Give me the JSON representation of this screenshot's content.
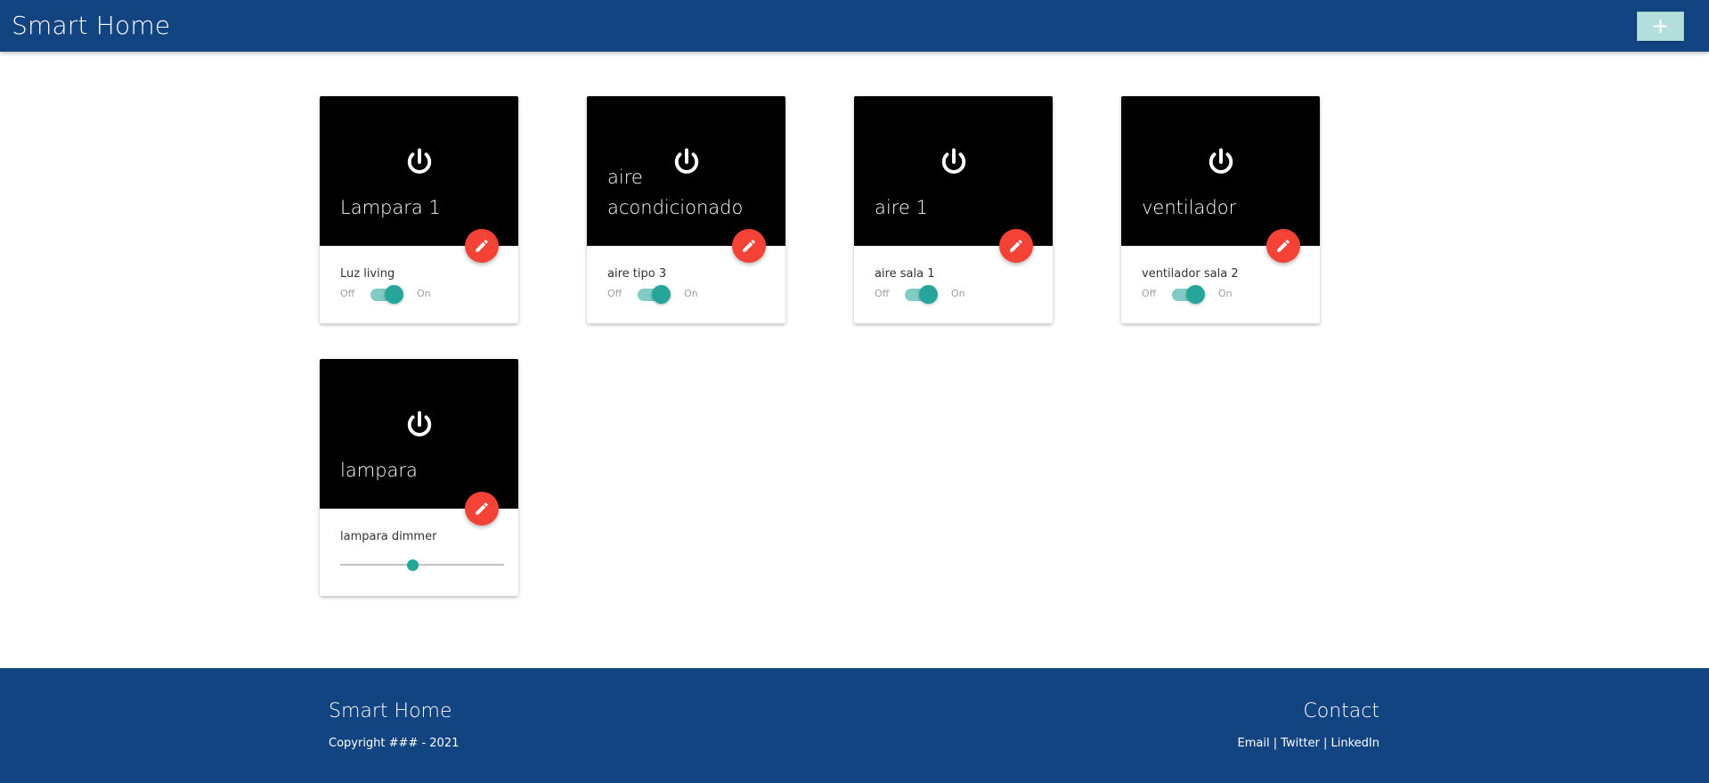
{
  "header": {
    "title": "Smart Home",
    "add_label": "+"
  },
  "devices": [
    {
      "name": "Lampara 1",
      "description": "Luz living",
      "control": "switch",
      "off_label": "Off",
      "on_label": "On",
      "state": "on"
    },
    {
      "name": "aire acondicionado",
      "description": "aire tipo 3",
      "control": "switch",
      "off_label": "Off",
      "on_label": "On",
      "state": "on"
    },
    {
      "name": "aire 1",
      "description": "aire sala 1",
      "control": "switch",
      "off_label": "Off",
      "on_label": "On",
      "state": "on"
    },
    {
      "name": "ventilador",
      "description": "ventilador sala 2",
      "control": "switch",
      "off_label": "Off",
      "on_label": "On",
      "state": "on"
    },
    {
      "name": "lampara",
      "description": "lampara dimmer",
      "control": "slider",
      "value": 0.44
    }
  ],
  "footer": {
    "title": "Smart Home",
    "copyright": "Copyright ### - 2021",
    "contact_title": "Contact",
    "links": [
      "Email",
      "Twitter",
      "LinkedIn"
    ],
    "separator": "|"
  },
  "colors": {
    "primary": "#134482",
    "accent": "#26a69a",
    "fab": "#f44336",
    "add_button": "#b2dfdb"
  },
  "icons": {
    "power": "power-icon",
    "edit": "pencil-icon",
    "add": "plus-icon"
  }
}
